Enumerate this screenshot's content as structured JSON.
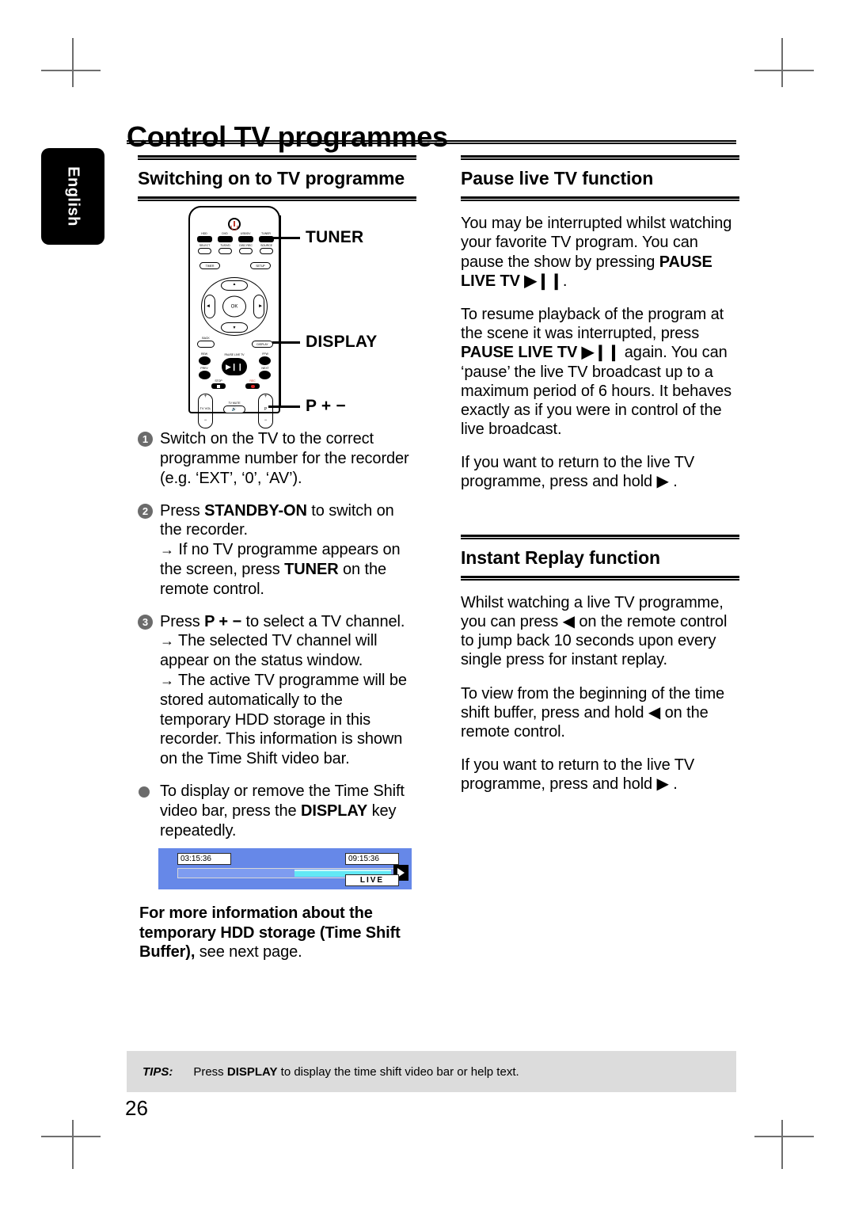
{
  "language_tab": "English",
  "page_title": "Control TV programmes",
  "page_number": "26",
  "left_column": {
    "section_title": "Switching on to TV programme",
    "remote": {
      "callouts": {
        "tuner": "TUNER",
        "display": "DISPLAY",
        "p_plus_minus": "P + −"
      },
      "buttons": {
        "power": "STANDBY-ON",
        "row1": [
          "HDD",
          "DVD",
          "USB/DV",
          "TUNER"
        ],
        "row2": [
          "SELECT",
          "TV/DVD",
          "DISC REC",
          "SOURCE"
        ],
        "timer": "TIMER",
        "setup": "SETUP",
        "ok": "OK",
        "back": "BACK",
        "display": "DISPLAY",
        "rew": "REW",
        "ffw": "FFW",
        "prev": "PREV",
        "next": "NEXT",
        "pause_live_tv": "PAUSE LIVE TV",
        "stop": "STOP",
        "rec": "REC",
        "tv_vol": "TV VOL",
        "tv_mute": "TV MUTE",
        "p": "P"
      }
    },
    "steps": [
      {
        "num": "1",
        "html": "Switch on the TV to the correct programme number for the recorder (e.g. ‘EXT’, ‘0’, ‘AV’)."
      },
      {
        "num": "2",
        "html": "Press <b>STANDBY-ON</b> to switch on the recorder.<br><span class=\"arrow\">→</span> If no TV programme appears on the screen, press <b>TUNER</b> on the remote control."
      },
      {
        "num": "3",
        "html": "Press <b>P &#43; &#8722;</b> to select a TV channel.<br><span class=\"arrow\">→</span> The selected TV channel will appear on the status window.<br><span class=\"arrow\">→</span> The active TV programme will be stored automatically to the temporary HDD storage in this recorder. This information is shown on the Time Shift video bar."
      }
    ],
    "bullet": "To display or remove the Time Shift video bar, press the <b>DISPLAY</b> key repeatedly.",
    "time_shift_bar": {
      "start_time": "03:15:36",
      "end_time": "09:15:36",
      "live_label": "LIVE",
      "progress_percent": 53,
      "bar_color": "#6688e8",
      "fill_color": "#62e8f5"
    },
    "note": "<b>For more information about the temporary HDD storage (Time Shift Buffer),</b> see next page."
  },
  "right_column": {
    "sections": [
      {
        "title": "Pause live TV function",
        "paragraphs": [
          "You may be interrupted whilst watching your favorite TV program.  You can pause the show by pressing <b>PAUSE LIVE TV ▶❙❙</b>.",
          "To resume playback of the program at the scene it was interrupted, press <b>PAUSE LIVE TV ▶❙❙</b> again. You can ‘pause’ the live TV broadcast up to a maximum period of 6 hours. It behaves exactly as if you were in control of the live broadcast.",
          "If you want to return to the live TV programme, press and hold ▶ ."
        ]
      },
      {
        "title": "Instant Replay function",
        "paragraphs": [
          "Whilst watching a live TV programme, you can press ◀ on the remote control to jump back 10 seconds upon every single press for instant replay.",
          "To view from the beginning of the time shift buffer, press and hold ◀ on the remote control.",
          "If you want to return to the live TV programme, press and hold ▶ ."
        ]
      }
    ]
  },
  "tips": {
    "label": "TIPS:",
    "text": "Press <b>DISPLAY</b> to display the time shift video bar or help text."
  }
}
